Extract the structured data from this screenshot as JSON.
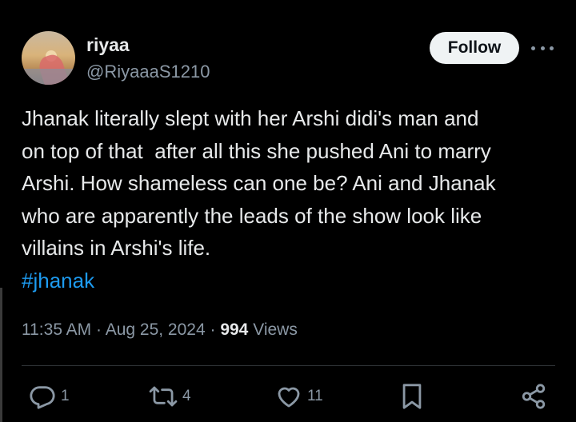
{
  "tweet": {
    "display_name": "riyaa",
    "handle": "@RiyaaaS1210",
    "follow_label": "Follow",
    "text": "Jhanak literally slept with her Arshi didi's man and\non top of that  after all this she pushed Ani to marry\nArshi. How shameless can one be? Ani and Jhanak\nwho are apparently the leads of the show look like\nvillains in Arshi's life.",
    "hashtag": "#jhanak",
    "time": "11:35 AM",
    "date": "Aug 25, 2024",
    "views_count": "994",
    "views_label": "Views"
  },
  "actions": {
    "reply_count": "1",
    "retweet_count": "4",
    "like_count": "11"
  },
  "icons": {
    "more": "more-dots-icon",
    "reply": "reply-icon",
    "retweet": "retweet-icon",
    "like": "heart-icon",
    "bookmark": "bookmark-icon",
    "share": "share-icon"
  },
  "colors": {
    "background": "#000000",
    "text": "#e7e9ea",
    "secondary": "#8b98a5",
    "link": "#1d9bf0",
    "follow_bg": "#eff3f4"
  }
}
